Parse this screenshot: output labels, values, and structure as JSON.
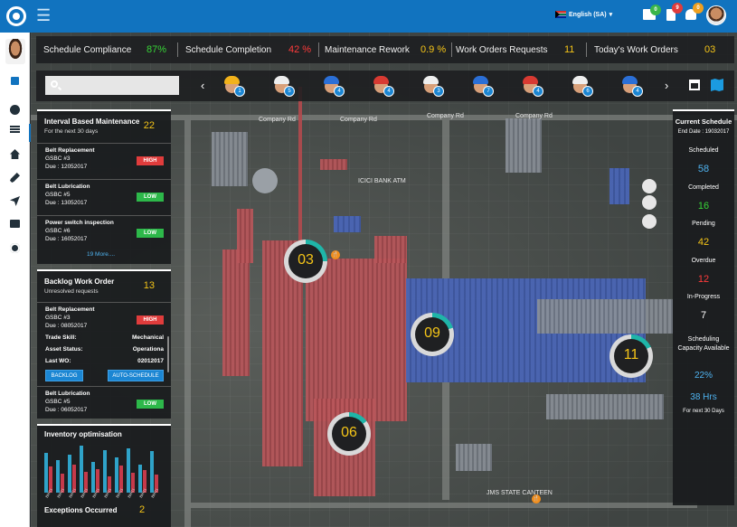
{
  "header": {
    "language": "English (SA)",
    "notifications": [
      {
        "icon": "mail-icon",
        "count": "0",
        "color": "#3ab54a"
      },
      {
        "icon": "document-icon",
        "count": "9",
        "color": "#e03c3c"
      },
      {
        "icon": "bell-icon",
        "count": "0",
        "color": "#f0a020"
      }
    ]
  },
  "kpis": [
    {
      "label": "Schedule Compliance",
      "value": "87%",
      "color": "#37d437"
    },
    {
      "label": "Schedule Completion",
      "value": "42 %",
      "color": "#ff3b3b"
    },
    {
      "label": "Maintenance Rework",
      "value": "0.9 %",
      "color": "#f5c518"
    },
    {
      "label": "Work Orders Requests",
      "value": "11",
      "color": "#f5c518"
    },
    {
      "label": "Today's Work Orders",
      "value": "03",
      "color": "#f5c518"
    }
  ],
  "search": {
    "placeholder": ""
  },
  "workers": [
    {
      "count": "1",
      "helmet": "#f2b21b"
    },
    {
      "count": "5",
      "helmet": "#eeeeee"
    },
    {
      "count": "4",
      "helmet": "#2b6fd6"
    },
    {
      "count": "4",
      "helmet": "#d83a32"
    },
    {
      "count": "3",
      "helmet": "#eeeeee"
    },
    {
      "count": "7",
      "helmet": "#2b6fd6"
    },
    {
      "count": "4",
      "helmet": "#d83a32"
    },
    {
      "count": "6",
      "helmet": "#eeeeee"
    },
    {
      "count": "4",
      "helmet": "#2b6fd6"
    }
  ],
  "interval": {
    "title": "Interval Based Maintenance",
    "subtitle": "For the next 30 days",
    "count": "22",
    "items": [
      {
        "title": "Belt Replacement",
        "asset": "GSBC #3",
        "due": "Due : 12052017",
        "priority": "HIGH"
      },
      {
        "title": "Belt Lubrication",
        "asset": "GSBC #5",
        "due": "Due : 13052017",
        "priority": "LOW"
      },
      {
        "title": "Power switch inspection",
        "asset": "GSBC #6",
        "due": "Due : 16052017",
        "priority": "LOW"
      }
    ],
    "more": "19 More...."
  },
  "backlog": {
    "title": "Backlog Work Order",
    "subtitle": "Unresolved requests",
    "count": "13",
    "item1": {
      "title": "Belt Replacement",
      "asset": "GSBC #3",
      "due": "Due : 08052017",
      "priority": "HIGH"
    },
    "trade_skill_label": "Trade Skill:",
    "trade_skill_value": "Mechanical",
    "asset_status_label": "Asset Status:",
    "asset_status_value": "Operationa",
    "last_wo_label": "Last WO:",
    "last_wo_value": "02012017",
    "btn_backlog": "BACKLOG",
    "btn_auto": "AUTO-SCHEDULE",
    "item2": {
      "title": "Belt Lubrication",
      "asset": "GSBC #5",
      "due": "Due : 06052017",
      "priority": "LOW"
    }
  },
  "inventory": {
    "title": "Inventory optimisation",
    "exceptions_label": "Exceptions Occurred",
    "exceptions_value": "2"
  },
  "chart_data": {
    "type": "bar",
    "categories": [
      "BMG1",
      "BMG1",
      "BMG1",
      "BMG1",
      "BMG1",
      "BMG1",
      "BMG1",
      "BMG1",
      "BMG1",
      "BMG1"
    ],
    "series": [
      {
        "values": [
          85,
          70,
          80,
          100,
          65,
          90,
          75,
          95,
          60,
          88
        ],
        "color": "#2fa3c9"
      },
      {
        "values": [
          55,
          40,
          60,
          45,
          50,
          35,
          58,
          42,
          48,
          38
        ],
        "color": "#c53a4a"
      }
    ],
    "title": "Inventory optimisation",
    "ylim": [
      0,
      100
    ]
  },
  "schedule": {
    "title": "Current Schedule",
    "end_date": "End Date : 19032017",
    "stats": [
      {
        "label": "Scheduled",
        "value": "58",
        "color": "#4fb3f0"
      },
      {
        "label": "Completed",
        "value": "16",
        "color": "#37d437"
      },
      {
        "label": "Pending",
        "value": "42",
        "color": "#f5c518"
      },
      {
        "label": "Overdue",
        "value": "12",
        "color": "#ff3b3b"
      },
      {
        "label": "In-Progress",
        "value": "7",
        "color": "#ffffff"
      }
    ],
    "capacity_label": "Scheduling Capacity Available",
    "capacity_pct": "22%",
    "capacity_hrs": "38 Hrs",
    "capacity_note": "For next 30 Days"
  },
  "map": {
    "labels": [
      "Company Rd",
      "Company Rd",
      "Company Rd",
      "Company Rd",
      "ICICI BANK ATM",
      "JMS STATE CANTEEN"
    ],
    "markers": [
      {
        "label": "03",
        "progress": 0.25
      },
      {
        "label": "09",
        "progress": 0.2
      },
      {
        "label": "11",
        "progress": 0.18
      },
      {
        "label": "06",
        "progress": 0.15
      }
    ]
  }
}
